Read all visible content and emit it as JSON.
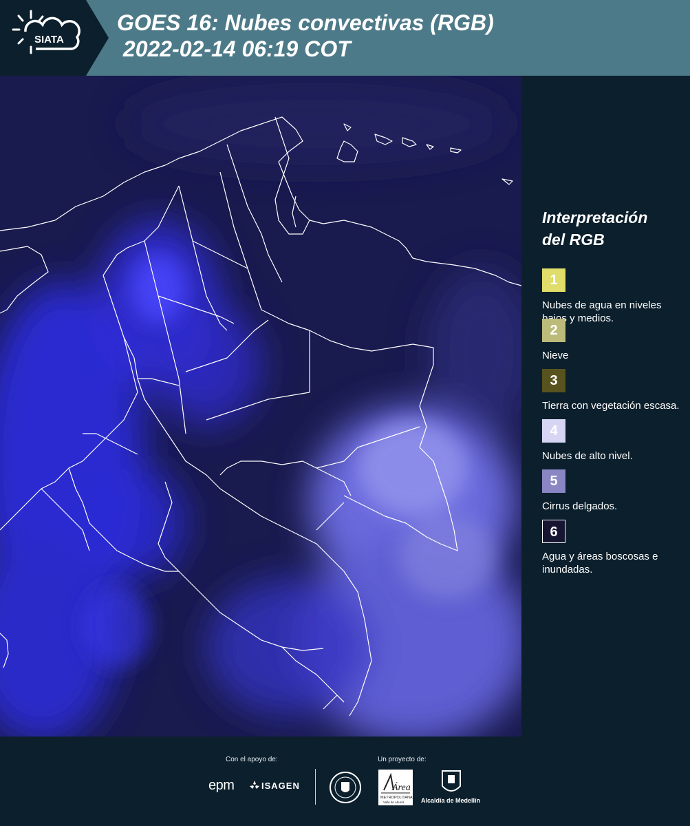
{
  "header": {
    "logo_text": "SIATA",
    "title_line1": "GOES 16: Nubes convectivas (RGB)",
    "title_line2": " 2022-02-14 06:19 COT"
  },
  "legend": {
    "title_line1": "Interpretación",
    "title_line2": "del RGB",
    "items": [
      {
        "number": "1",
        "label": "Nubes de agua en niveles bajos y medios.",
        "color": "#e0dd6a"
      },
      {
        "number": "2",
        "label": "Nieve",
        "color": "#bcbb7a"
      },
      {
        "number": "3",
        "label": "Tierra con vegetación escasa.",
        "color": "#58521e"
      },
      {
        "number": "4",
        "label": "Nubes de alto nivel.",
        "color": "#d6d6f4"
      },
      {
        "number": "5",
        "label": "Cirrus delgados.",
        "color": "#8a86c4"
      },
      {
        "number": "6",
        "label": "Agua y áreas boscosas e inundadas.",
        "color": "#161633"
      }
    ]
  },
  "footer": {
    "support_label": "Con el apoyo de:",
    "project_label": "Un proyecto de:",
    "sponsor_epm": "epm",
    "sponsor_isagen": "ISAGEN",
    "area_label": "Área",
    "area_sub": "METROPOLITANA",
    "area_sub2": "Valle de Aburrá",
    "alcaldia_label": "Alcaldía de Medellín"
  },
  "colors": {
    "header_bg": "#4d7a88",
    "page_bg": "#0c1f2c",
    "map_bg": "#191a4e",
    "cloud_blue": "#3a3aff",
    "border_line": "#ffffff"
  }
}
